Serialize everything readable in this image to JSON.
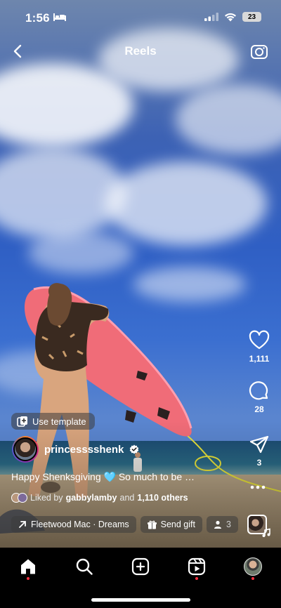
{
  "status_bar": {
    "time": "1:56",
    "battery": "23"
  },
  "header": {
    "title": "Reels"
  },
  "rail": {
    "likes": "1,111",
    "comments": "28",
    "shares": "3"
  },
  "overlay": {
    "template_label": "Use template",
    "username": "princesssshenk",
    "caption": "Happy Shenksgiving 🩵 So much to be …",
    "liked_prefix": "Liked by",
    "liked_user": "gabbylamby",
    "liked_mid": "and",
    "liked_others": "1,110 others",
    "audio_label": "Fleetwood Mac · Dreams",
    "gift_label": "Send gift",
    "people_count": "3"
  },
  "colors": {
    "accent_red": "#ff3040",
    "sky": "#2f5fc4"
  },
  "icons": [
    "bed-icon",
    "signal-icon",
    "wifi-icon",
    "battery-icon",
    "back-icon",
    "camera-icon",
    "heart-icon",
    "comment-icon",
    "share-icon",
    "more-icon",
    "template-icon",
    "verified-icon",
    "arrow-up-right-icon",
    "gift-icon",
    "person-icon",
    "music-note-icon",
    "home-icon",
    "search-icon",
    "create-icon",
    "reels-icon",
    "profile-avatar"
  ]
}
